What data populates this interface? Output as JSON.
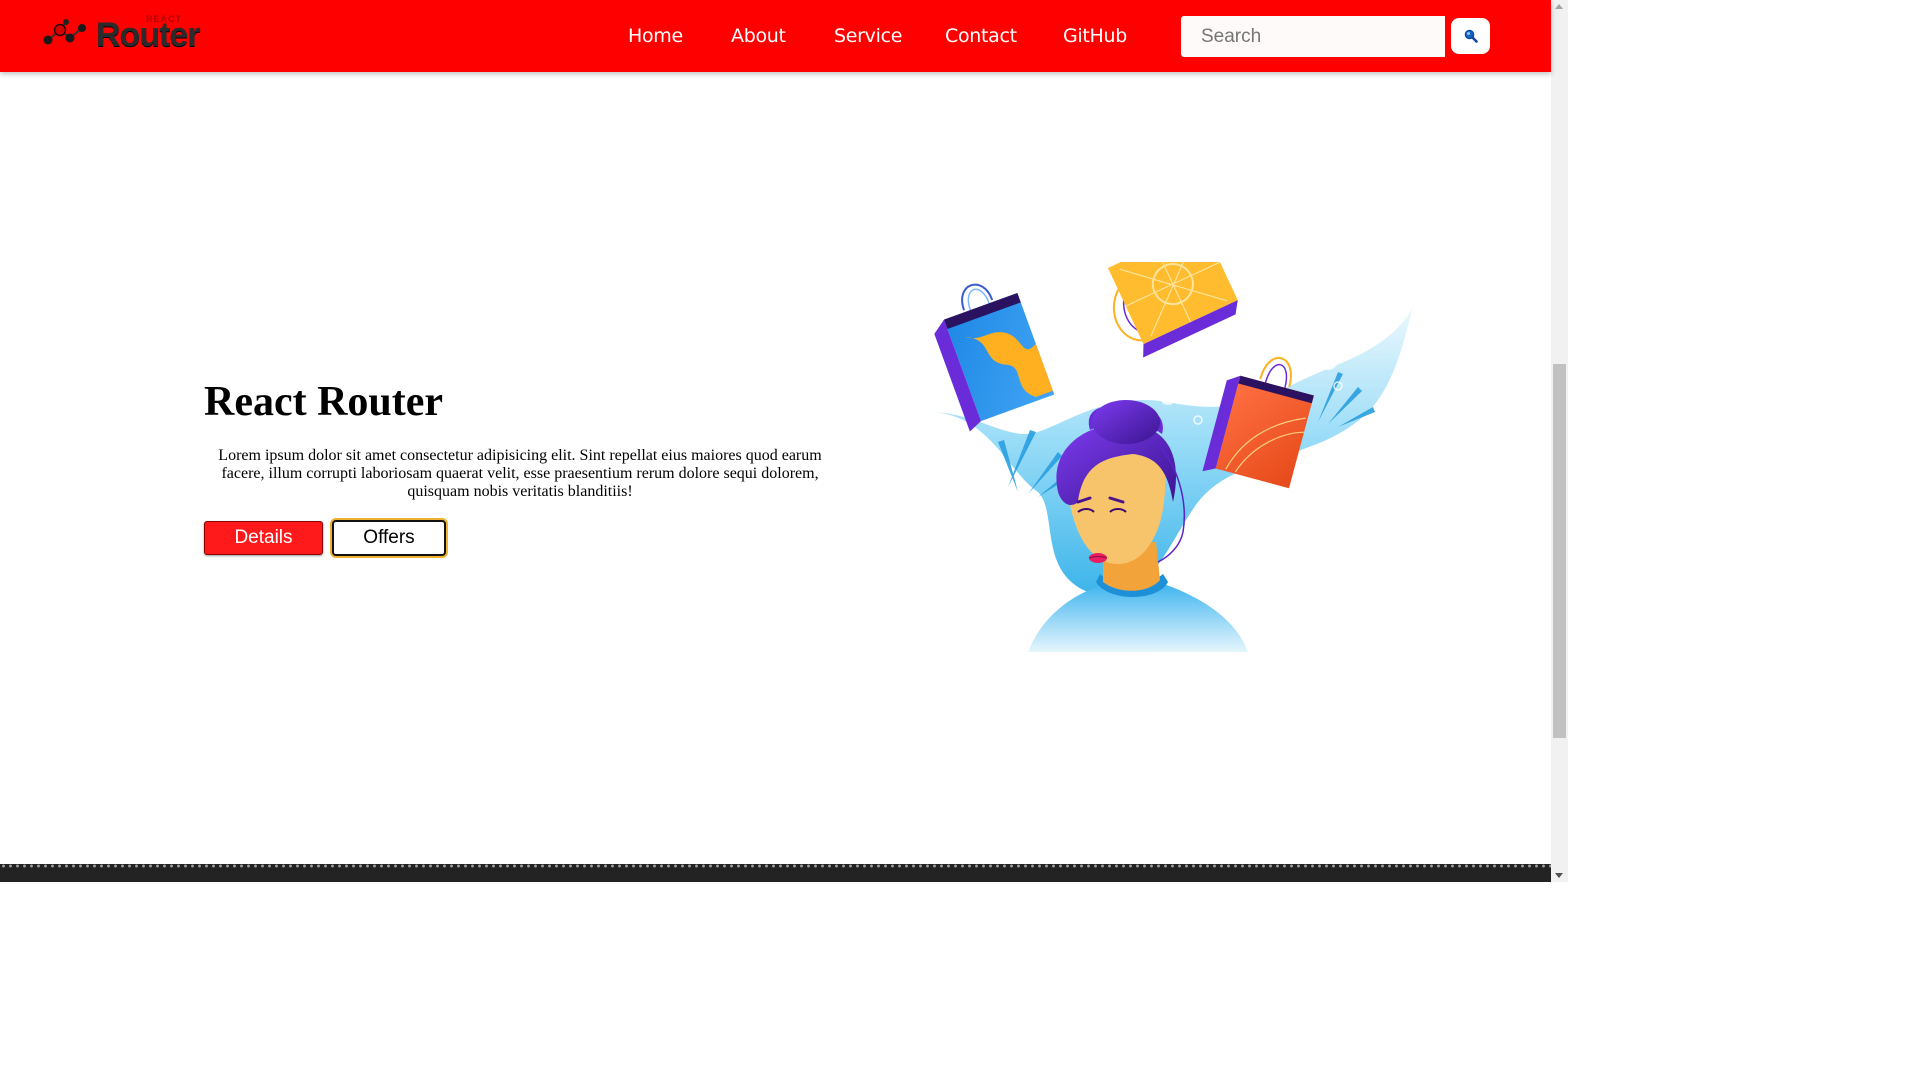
{
  "brand": {
    "small_text": "REACT",
    "name": "Router",
    "icon": "molecule-logo-icon"
  },
  "nav": {
    "items": [
      {
        "label": "Home"
      },
      {
        "label": "About"
      },
      {
        "label": "Service"
      },
      {
        "label": "Contact"
      },
      {
        "label": "GitHub"
      }
    ]
  },
  "search": {
    "placeholder": "Search",
    "value": "",
    "button_icon": "search-icon"
  },
  "hero": {
    "title": "React Router",
    "body": "Lorem ipsum dolor sit amet consectetur adipisicing elit. Sint repellat eius maiores quod earum facere, illum corrupti laboriosam quaerat velit, esse praesentium rerum dolore sequi dolorem, quisquam nobis veritatis blanditiis!",
    "details_label": "Details",
    "offers_label": "Offers",
    "illustration": "woman-shopping-bags-illustration"
  },
  "colors": {
    "navbar": "#fe0000",
    "details_button": "#fe1a1a",
    "offers_border": "#111111",
    "offers_glow": "#f0b030",
    "footer": "#232323"
  }
}
